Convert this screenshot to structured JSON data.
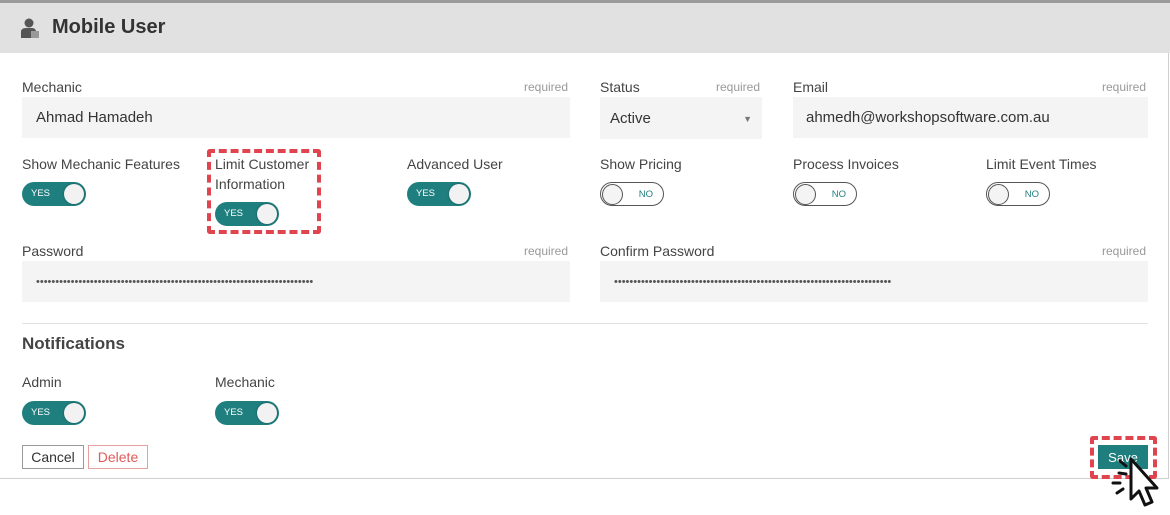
{
  "header": {
    "title": "Mobile User",
    "icon": "user-icon"
  },
  "form": {
    "mechanic": {
      "label": "Mechanic",
      "required": "required",
      "value": "Ahmad Hamadeh"
    },
    "status": {
      "label": "Status",
      "required": "required",
      "value": "Active"
    },
    "email": {
      "label": "Email",
      "required": "required",
      "value": "ahmedh@workshopsoftware.com.au"
    },
    "toggles": [
      {
        "label": "Show Mechanic Features",
        "state": "YES"
      },
      {
        "label": "Limit Customer Information",
        "state": "YES"
      },
      {
        "label": "Advanced User",
        "state": "YES"
      },
      {
        "label": "Show Pricing",
        "state": "NO"
      },
      {
        "label": "Process Invoices",
        "state": "NO"
      },
      {
        "label": "Limit Event Times",
        "state": "NO"
      }
    ],
    "password": {
      "label": "Password",
      "required": "required",
      "value": "••••••••••••••••••••••••••••••••••••••••••••••••••••••••••••••••••••••••"
    },
    "confirm_password": {
      "label": "Confirm Password",
      "required": "required",
      "value": "••••••••••••••••••••••••••••••••••••••••••••••••••••••••••••••••••••••••"
    }
  },
  "notifications": {
    "title": "Notifications",
    "toggles": [
      {
        "label": "Admin",
        "state": "YES"
      },
      {
        "label": "Mechanic",
        "state": "YES"
      }
    ]
  },
  "actions": {
    "cancel": "Cancel",
    "delete": "Delete",
    "save": "Save"
  },
  "colors": {
    "accent": "#1f7f7f",
    "highlight": "#e0454f",
    "header_bg": "#e1e1e1",
    "field_bg": "#f4f4f4"
  }
}
